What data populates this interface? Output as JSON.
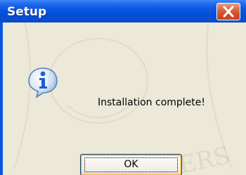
{
  "window": {
    "title": "Setup"
  },
  "dialog": {
    "message": "Installation complete!",
    "icon": "information-icon"
  },
  "buttons": {
    "ok_label": "OK",
    "close_icon": "close-icon"
  },
  "watermark": {
    "text": "ERS"
  },
  "colors": {
    "titlebar": "#0a58e2",
    "close_button": "#d24a20",
    "dialog_background": "#ece9d8",
    "info_icon": "#1e5ed0"
  }
}
